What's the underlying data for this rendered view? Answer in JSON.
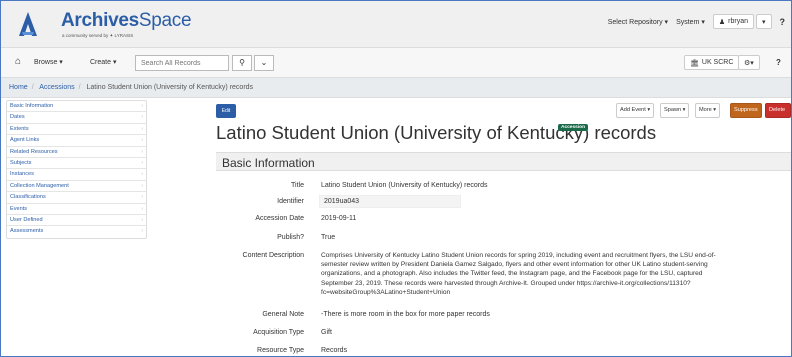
{
  "header": {
    "brand_bold": "Archives",
    "brand_light": "Space",
    "tagline": "a community served by ✦ LYRASIS",
    "select_repo": "Select Repository ▾",
    "system": "System ▾",
    "user": "rbryan",
    "caret": "▾",
    "help": "?"
  },
  "nav": {
    "browse": "Browse ▾",
    "create": "Create ▾",
    "search_placeholder": "Search All Records",
    "repo": "UK SCRC",
    "gear_menu": "▾",
    "help": "?"
  },
  "breadcrumb": [
    "Home",
    "Accessions",
    "Latino Student Union (University of Kentucky) records"
  ],
  "sidebar": {
    "items": [
      "Basic Information",
      "Dates",
      "Extents",
      "Agent Links",
      "Related Resources",
      "Subjects",
      "Instances",
      "Collection Management",
      "Classifications",
      "Events",
      "User Defined",
      "Assessments"
    ]
  },
  "toolbar": {
    "edit": "Edit",
    "add_event": "Add Event ▾",
    "spawn": "Spawn ▾",
    "more": "More ▾",
    "suppress": "Suppress",
    "delete": "Delete"
  },
  "record": {
    "title": "Latino Student Union (University of Kentucky) records",
    "badge": "Accession",
    "section": "Basic Information"
  },
  "fields": {
    "title_label": "Title",
    "title_value": "Latino Student Union (University of Kentucky) records",
    "identifier_label": "Identifier",
    "identifier_value": "2019ua043",
    "date_label": "Accession Date",
    "date_value": "2019-09-11",
    "publish_label": "Publish?",
    "publish_value": "True",
    "content_label": "Content Description",
    "content_value": "Comprises University of Kentucky Latino Student Union records for spring 2019, including event and recruitment flyers, the LSU end-of-semester review written by President Daniela Gamez Salgado, flyers and other event information for other UK Latino student-serving organizations, and a photograph. Also includes the Twitter feed, the Instagram page, and the Facebook page for the LSU, captured September 23, 2019. These records were harvested through Archive-It. Grouped under https://archive-it.org/collections/11310?fc=websiteGroup%3ALatino+Student+Union",
    "note_label": "General Note",
    "note_value": "-There is more room in the box for more paper records",
    "acq_label": "Acquisition Type",
    "acq_value": "Gift",
    "res_label": "Resource Type",
    "res_value": "Records"
  },
  "colors": {
    "brand": "#2b5ea7",
    "suppress": "#c0661c",
    "delete": "#c9302c",
    "badge": "#1a6a4a"
  }
}
